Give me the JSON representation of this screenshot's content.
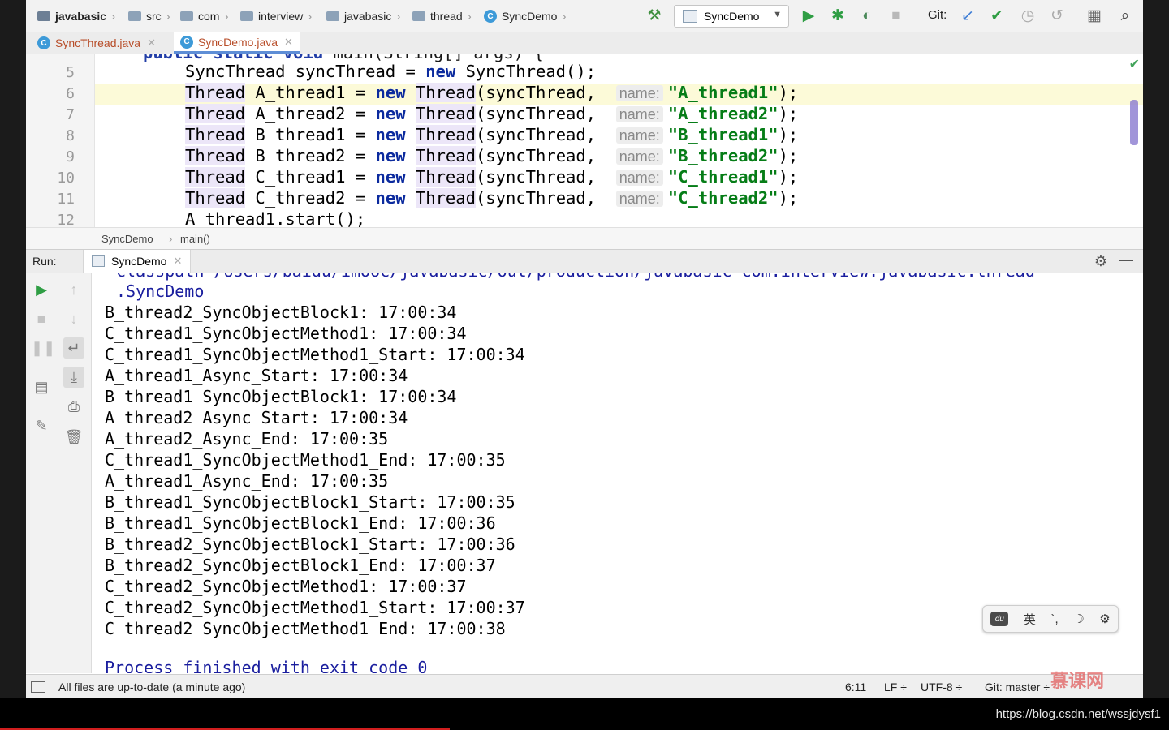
{
  "breadcrumb": [
    "javabasic",
    "src",
    "com",
    "interview",
    "javabasic",
    "thread",
    "SyncDemo"
  ],
  "run_config": "SyncDemo",
  "git_label": "Git:",
  "tabs": [
    {
      "label": "SyncThread.java",
      "active": false
    },
    {
      "label": "SyncDemo.java",
      "active": true
    }
  ],
  "editor": {
    "lines": [
      {
        "num": "5",
        "text": "SyncThread syncThread = new SyncThread();"
      },
      {
        "num": "6",
        "var": "A_thread1",
        "name": "\"A_thread1\""
      },
      {
        "num": "7",
        "var": "A_thread2",
        "name": "\"A_thread2\""
      },
      {
        "num": "8",
        "var": "B_thread1",
        "name": "\"B_thread1\""
      },
      {
        "num": "9",
        "var": "B_thread2",
        "name": "\"B_thread2\""
      },
      {
        "num": "10",
        "var": "C_thread1",
        "name": "\"C_thread1\""
      },
      {
        "num": "11",
        "var": "C_thread2",
        "name": "\"C_thread2\""
      },
      {
        "num": "12",
        "text": "A_thread1.start();"
      }
    ],
    "type_thread": "Thread",
    "kw_new": "new",
    "ctor_arg": "(syncThread,",
    "hint_name": "name:",
    "line_end": ");",
    "crumb_class": "SyncDemo",
    "crumb_method": "main()"
  },
  "run": {
    "label": "Run:",
    "tab": "SyncDemo",
    "console": [
      ".SyncDemo",
      "B_thread2_SyncObjectBlock1: 17:00:34",
      "C_thread1_SyncObjectMethod1: 17:00:34",
      "C_thread1_SyncObjectMethod1_Start: 17:00:34",
      "A_thread1_Async_Start: 17:00:34",
      "B_thread1_SyncObjectBlock1: 17:00:34",
      "A_thread2_Async_Start: 17:00:34",
      "A_thread2_Async_End: 17:00:35",
      "C_thread1_SyncObjectMethod1_End: 17:00:35",
      "A_thread1_Async_End: 17:00:35",
      "B_thread1_SyncObjectBlock1_Start: 17:00:35",
      "B_thread1_SyncObjectBlock1_End: 17:00:36",
      "B_thread2_SyncObjectBlock1_Start: 17:00:36",
      "B_thread2_SyncObjectBlock1_End: 17:00:37",
      "C_thread2_SyncObjectMethod1: 17:00:37",
      "C_thread2_SyncObjectMethod1_Start: 17:00:37",
      "C_thread2_SyncObjectMethod1_End: 17:00:38",
      "",
      "Process finished with exit code 0"
    ]
  },
  "status": {
    "message": "All files are up-to-date (a minute ago)",
    "position": "6:11",
    "line_sep": "LF ÷",
    "encoding": "UTF-8 ÷",
    "git": "Git: master ÷"
  },
  "ime": [
    "英",
    "`,",
    "☽",
    "⚙"
  ],
  "watermark_url": "https://blog.csdn.net/wssjdysf1",
  "video_progress": 0.385,
  "colors": {
    "keyword": "#0b2a9e",
    "string": "#067d17",
    "console_path": "#1a1e9e",
    "accent": "#5e8ed6"
  }
}
